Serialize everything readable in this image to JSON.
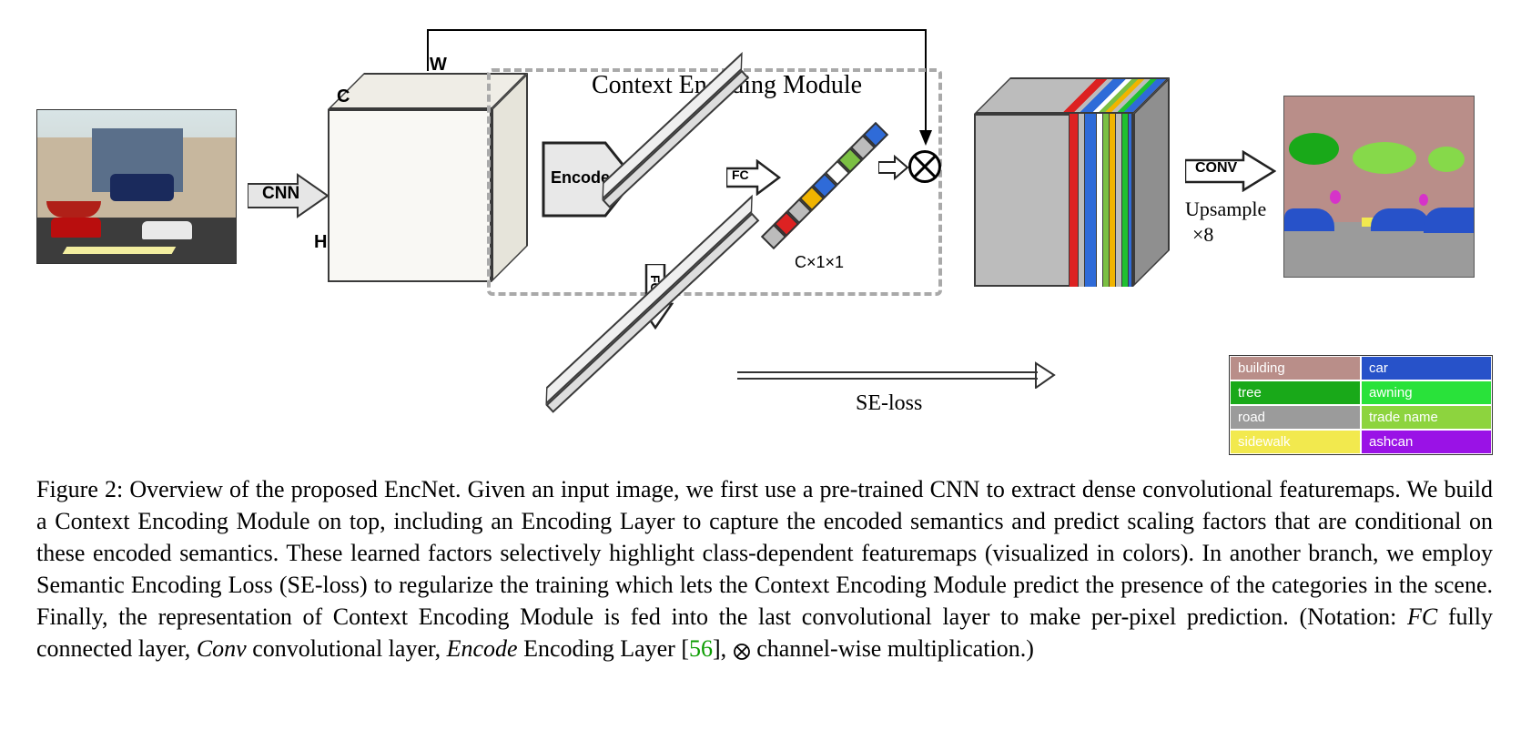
{
  "labels": {
    "cnn": "CNN",
    "c": "C",
    "w": "W",
    "h": "H",
    "encode": "Encode",
    "module_title": "Context Encoding Module",
    "fc1": "FC",
    "fc2": "FC",
    "c11": "C×1×1",
    "seloss": "SE-loss",
    "conv": "CONV",
    "upsample": "Upsample",
    "times8": "×8"
  },
  "legend": [
    {
      "name": "building",
      "color": "#b98e89"
    },
    {
      "name": "car",
      "color": "#2752c9"
    },
    {
      "name": "tree",
      "color": "#19a919"
    },
    {
      "name": "awning",
      "color": "#29e23a"
    },
    {
      "name": "road",
      "color": "#9b9b9b"
    },
    {
      "name": "trade name",
      "color": "#8dd43e"
    },
    {
      "name": "sidewalk",
      "color": "#f2e94e"
    },
    {
      "name": "ashcan",
      "color": "#9a12e6"
    }
  ],
  "caption": {
    "head": "Figure 2: Overview of the proposed EncNet.",
    "body1": " Given an input image, we first use a pre-trained CNN to extract dense convolutional featuremaps. We build a Context Encoding Module on top, including an Encoding Layer to capture the encoded semantics and predict scaling factors that are conditional on these encoded semantics. These learned factors selectively highlight class-dependent featuremaps (visualized in colors). In another branch, we employ Semantic Encoding Loss (SE-loss) to regularize the training which lets the Context Encoding Module predict the presence of the categories in the scene. Finally, the representation of Context Encoding Module is fed into the last convolutional layer to make per-pixel prediction. (Notation: ",
    "fc": "FC",
    "body2": " fully connected layer, ",
    "conv": "Conv",
    "body3": " convolutional layer, ",
    "encode": "Encode",
    "body4": " Encoding Layer [",
    "ref": "56",
    "body5": "], ",
    "otimes": "⊗",
    "body6": " channel-wise multiplication.)"
  },
  "svec_colors": [
    "#2f6bd8",
    "#bcbcbc",
    "#7bc043",
    "#fff",
    "#2f6bd8",
    "#f0b400",
    "#bcbcbc",
    "#d22",
    "#bcbcbc"
  ]
}
